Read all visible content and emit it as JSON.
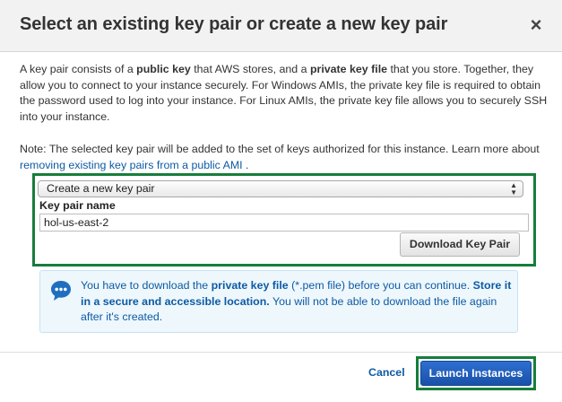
{
  "dialog": {
    "title": "Select an existing key pair or create a new key pair",
    "close_glyph": "×"
  },
  "intro": {
    "t1": "A key pair consists of a ",
    "b1": "public key",
    "t2": " that AWS stores, and a ",
    "b2": "private key file",
    "t3": " that you store. Together, they allow you to connect to your instance securely. For Windows AMIs, the private key file is required to obtain the password used to log into your instance. For Linux AMIs, the private key file allows you to securely SSH into your instance."
  },
  "note": {
    "t1": "Note: The selected key pair will be added to the set of keys authorized for this instance. Learn more about ",
    "link": "removing existing key pairs from a public AMI",
    "t2": " ."
  },
  "key_pair": {
    "selected_option": "Create a new key pair",
    "name_label": "Key pair name",
    "name_value": "hol-us-east-2",
    "download_label": "Download Key Pair"
  },
  "info": {
    "t1": "You have to download the ",
    "b1": "private key file",
    "t2": " (*.pem file) before you can continue. ",
    "b2": "Store it in a secure and accessible location.",
    "t3": " You will not be able to download the file again after it's created.",
    "icon": "chat-bubble-icon"
  },
  "footer": {
    "cancel_label": "Cancel",
    "launch_label": "Launch Instances"
  },
  "colors": {
    "accent_link": "#0d5ba4",
    "highlight_outline": "#177d3c",
    "primary_button": "#1f5fbf",
    "info_background": "#eef7fc"
  }
}
